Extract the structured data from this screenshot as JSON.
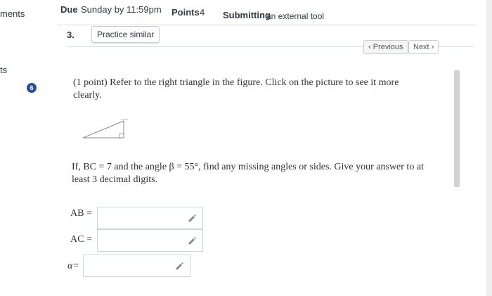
{
  "sidebar": {
    "fragment_top": "ments",
    "fragment_mid": "ts",
    "question_badge": "6"
  },
  "header": {
    "due_label": "Due",
    "due_value": "Sunday by 11:59pm",
    "points_label": "Points",
    "points_value": "4",
    "submitting_label": "Submitting",
    "submitting_value": "an external tool"
  },
  "question": {
    "number": "3.",
    "practice_button": "Practice similar",
    "previous_button": "Previous",
    "next_button": "Next",
    "intro": "(1 point) Refer to the right triangle in the figure. Click on the picture to see it more clearly.",
    "prompt": "If, BC = 7 and the angle β = 55°, find any missing angles or sides. Give your answer to at least 3 decimal digits."
  },
  "answers": [
    {
      "label": "AB =",
      "value": ""
    },
    {
      "label": "AC =",
      "value": ""
    },
    {
      "label": "α=",
      "value": ""
    }
  ]
}
